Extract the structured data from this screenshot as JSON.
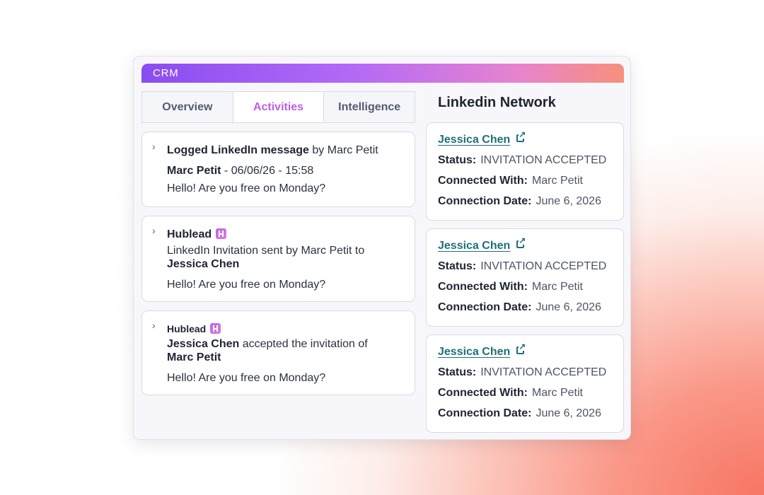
{
  "crm": {
    "title": "CRM"
  },
  "tabs": [
    {
      "label": "Overview",
      "active": false
    },
    {
      "label": "Activities",
      "active": true
    },
    {
      "label": "Intelligence",
      "active": false
    }
  ],
  "activities": [
    {
      "heading": "Logged LinkedIn message",
      "heading_suffix": "by Marc Petit",
      "author": "Marc Petit",
      "meta": "- 06/06/26 - 15:58",
      "message": "Hello! Are you free on Monday?"
    },
    {
      "heading": "Hublead",
      "text": "LinkedIn Invitation sent by Marc Petit to",
      "target": "Jessica Chen",
      "message": "Hello! Are you free on Monday?"
    },
    {
      "heading": "Hublead",
      "actor": "Jessica Chen",
      "text": "accepted the invitation of",
      "target": "Marc Petit",
      "message": "Hello! Are you free on Monday?"
    }
  ],
  "network": {
    "title": "Linkedin Network",
    "labels": {
      "status": "Status:",
      "connected_with": "Connected With:",
      "connection_date": "Connection Date:"
    },
    "connections": [
      {
        "name": "Jessica Chen",
        "status": "INVITATION ACCEPTED",
        "connected_with": "Marc Petit",
        "date": "June 6, 2026"
      },
      {
        "name": "Jessica Chen",
        "status": "INVITATION ACCEPTED",
        "connected_with": "Marc Petit",
        "date": "June 6, 2026"
      },
      {
        "name": "Jessica Chen",
        "status": "INVITATION ACCEPTED",
        "connected_with": "Marc Petit",
        "date": "June 6, 2026"
      }
    ]
  },
  "colors": {
    "accent": "#bd5ee6",
    "link": "#1f6f7a",
    "header_start": "#8a4cf2",
    "header_end": "#f7907a"
  },
  "icons": {
    "expand": "chevron-right-icon",
    "hublead": "hublead-logo-icon",
    "external": "external-link-icon"
  }
}
